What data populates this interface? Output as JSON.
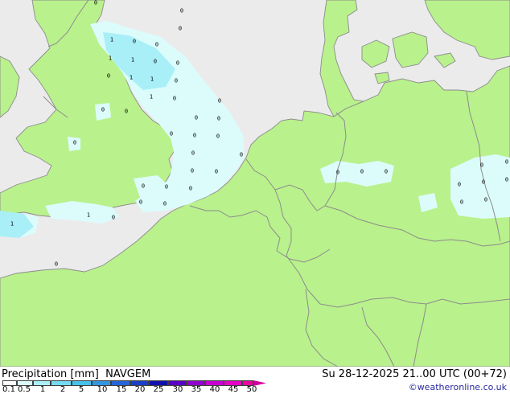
{
  "map": {
    "colors": {
      "sea": "#ebebeb",
      "land": "#b9f18c",
      "precip_light": "#dcfcfc",
      "precip_medium": "#a9eff8",
      "borders": "#8c8c8c"
    },
    "value_labels": [
      "0",
      "1",
      "0",
      "0",
      "1",
      "1",
      "0",
      "0",
      "0",
      "1",
      "0",
      "1",
      "1",
      "0",
      "0",
      "0",
      "0",
      "0",
      "0",
      "0",
      "0",
      "0",
      "0",
      "0",
      "0",
      "0",
      "0",
      "0",
      "0",
      "0",
      "0",
      "0",
      "1",
      "1",
      "0",
      "0",
      "0",
      "0",
      "0",
      "0",
      "0",
      "0",
      "0",
      "0",
      "0",
      "0",
      "0",
      "0"
    ]
  },
  "footer": {
    "title_left": "Precipitation [mm]  NAVGEM",
    "title_right": "Su 28-12-2025 21..00 UTC (00+72)",
    "credit": "©weatheronline.co.uk"
  },
  "legend": {
    "ticks": [
      "0.1",
      "0.5",
      "1",
      "2",
      "5",
      "10",
      "15",
      "20",
      "25",
      "30",
      "35",
      "40",
      "45",
      "50"
    ],
    "colors": [
      "#fefefe",
      "#dcfcfc",
      "#a9eff8",
      "#72dcf2",
      "#46c1ec",
      "#2f97e0",
      "#2564d8",
      "#1a3ec8",
      "#1010b0",
      "#5a00c8",
      "#9100d0",
      "#c800d4",
      "#e800c8",
      "#f000a0"
    ],
    "arrow_color": "#d0009a"
  }
}
